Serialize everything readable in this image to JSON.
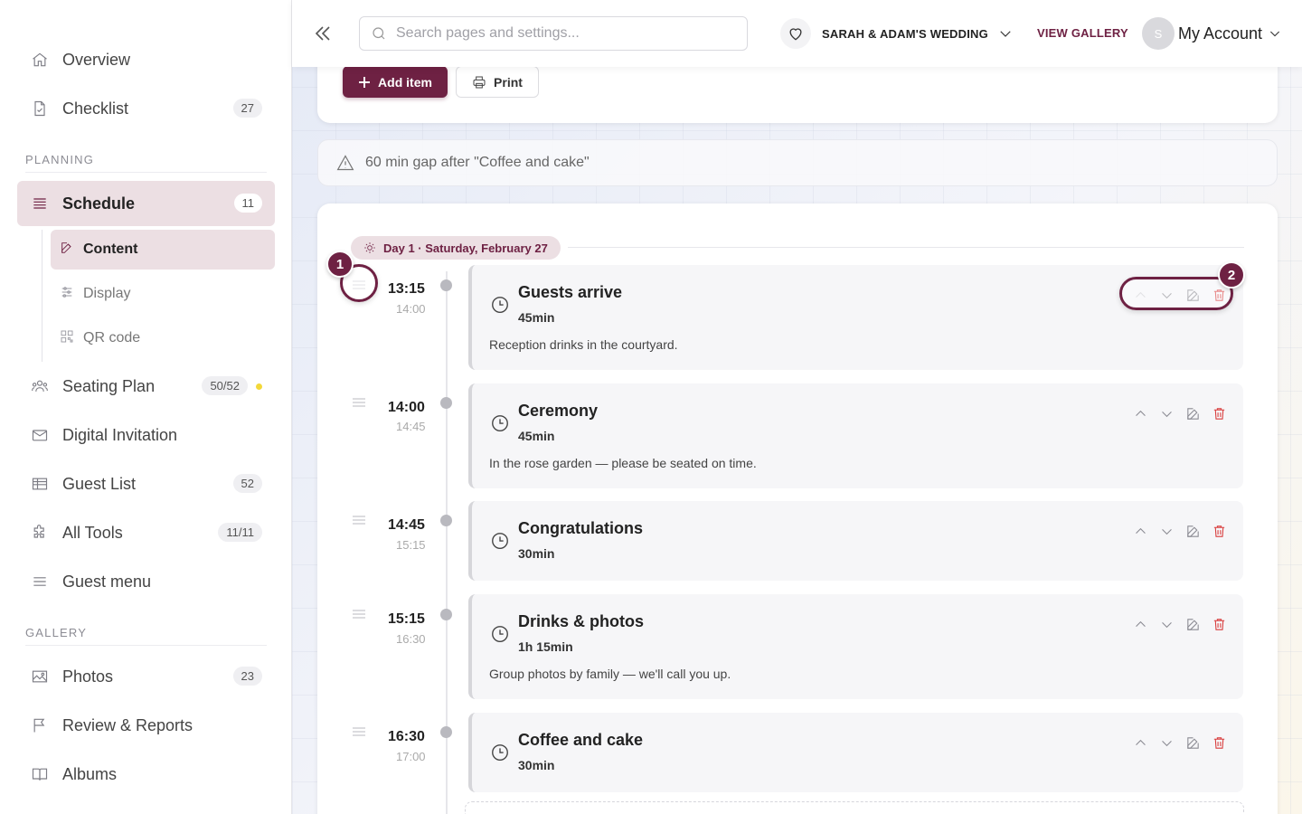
{
  "sidebar": {
    "top_items": [
      {
        "label": "Overview"
      },
      {
        "label": "Checklist",
        "badge": "27"
      }
    ],
    "planning_label": "PLANNING",
    "schedule": {
      "label": "Schedule",
      "badge": "11"
    },
    "sub_items": [
      {
        "label": "Content"
      },
      {
        "label": "Display"
      },
      {
        "label": "QR code"
      }
    ],
    "items": [
      {
        "label": "Seating Plan",
        "badge": "50/52"
      },
      {
        "label": "Digital Invitation"
      },
      {
        "label": "Guest List",
        "badge": "52"
      },
      {
        "label": "All Tools",
        "badge": "11/11"
      },
      {
        "label": "Guest menu"
      }
    ],
    "gallery_label": "GALLERY",
    "gallery_items": [
      {
        "label": "Photos",
        "badge": "23"
      },
      {
        "label": "Review & Reports"
      },
      {
        "label": "Albums"
      }
    ]
  },
  "topbar": {
    "search_placeholder": "Search pages and settings...",
    "event_name": "SARAH & ADAM'S WEDDING",
    "view_gallery": "VIEW GALLERY",
    "avatar_initial": "S",
    "account_label": "My Account"
  },
  "toolbar": {
    "add_label": "Add item",
    "print_label": "Print"
  },
  "warning": {
    "text": "60 min gap after \"Coffee and cake\""
  },
  "schedule": {
    "day_label": "Day 1 · Saturday, February 27",
    "items": [
      {
        "start": "13:15",
        "end": "14:00",
        "title": "Guests arrive",
        "duration": "45min",
        "description": "Reception drinks in the courtyard."
      },
      {
        "start": "14:00",
        "end": "14:45",
        "title": "Ceremony",
        "duration": "45min",
        "description": "In the rose garden — please be seated on time."
      },
      {
        "start": "14:45",
        "end": "15:15",
        "title": "Congratulations",
        "duration": "30min",
        "description": ""
      },
      {
        "start": "15:15",
        "end": "16:30",
        "title": "Drinks & photos",
        "duration": "1h 15min",
        "description": "Group photos by family — we'll call you up."
      },
      {
        "start": "16:30",
        "end": "17:00",
        "title": "Coffee and cake",
        "duration": "30min",
        "description": ""
      }
    ]
  },
  "annotations": {
    "badge_1": "1",
    "badge_2": "2"
  },
  "colors": {
    "accent": "#6e2143",
    "accent_light": "#ecdfe3",
    "danger": "#d83a3a",
    "warning_dot": "#f3d83a"
  }
}
